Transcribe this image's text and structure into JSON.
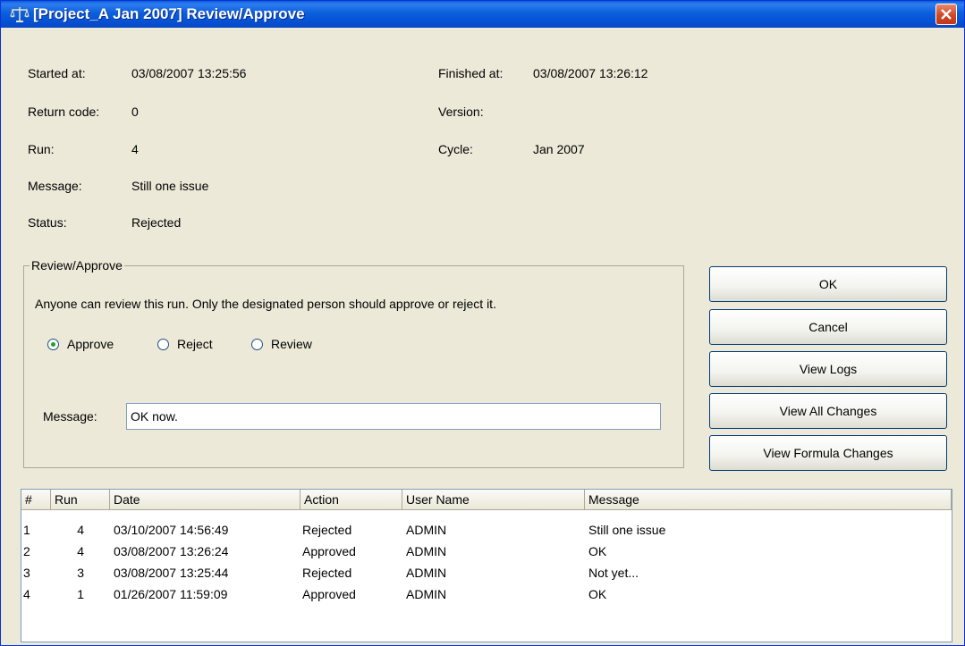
{
  "window": {
    "title": "[Project_A Jan 2007] Review/Approve",
    "title_icon": "scales-icon",
    "close_icon": "close-icon",
    "accent": "#0a5fd6"
  },
  "info": {
    "started_label": "Started at:",
    "started_value": "03/08/2007 13:25:56",
    "finished_label": "Finished at:",
    "finished_value": "03/08/2007 13:26:12",
    "return_code_label": "Return code:",
    "return_code_value": "0",
    "version_label": "Version:",
    "version_value": "",
    "run_label": "Run:",
    "run_value": "4",
    "cycle_label": "Cycle:",
    "cycle_value": "Jan 2007",
    "message_label": "Message:",
    "message_value": "Still one issue",
    "status_label": "Status:",
    "status_value": "Rejected"
  },
  "review": {
    "group_title": "Review/Approve",
    "instruction": "Anyone can review this run. Only the designated person should approve or reject it.",
    "options": [
      {
        "label": "Approve",
        "selected": true
      },
      {
        "label": "Reject",
        "selected": false
      },
      {
        "label": "Review",
        "selected": false
      }
    ],
    "message_label": "Message:",
    "message_value": "OK now."
  },
  "buttons": {
    "ok": "OK",
    "cancel": "Cancel",
    "view_logs": "View Logs",
    "view_all_changes": "View All Changes",
    "view_formula_changes": "View Formula Changes"
  },
  "history": {
    "columns": [
      "#",
      "Run",
      "Date",
      "Action",
      "User Name",
      "Message"
    ],
    "rows": [
      [
        "1",
        "4",
        "03/10/2007 14:56:49",
        "Rejected",
        "ADMIN",
        "Still one issue"
      ],
      [
        "2",
        "4",
        "03/08/2007 13:26:24",
        "Approved",
        "ADMIN",
        "OK"
      ],
      [
        "3",
        "3",
        "03/08/2007 13:25:44",
        "Rejected",
        "ADMIN",
        "Not yet..."
      ],
      [
        "4",
        "1",
        "01/26/2007 11:59:09",
        "Approved",
        "ADMIN",
        "OK"
      ]
    ]
  }
}
